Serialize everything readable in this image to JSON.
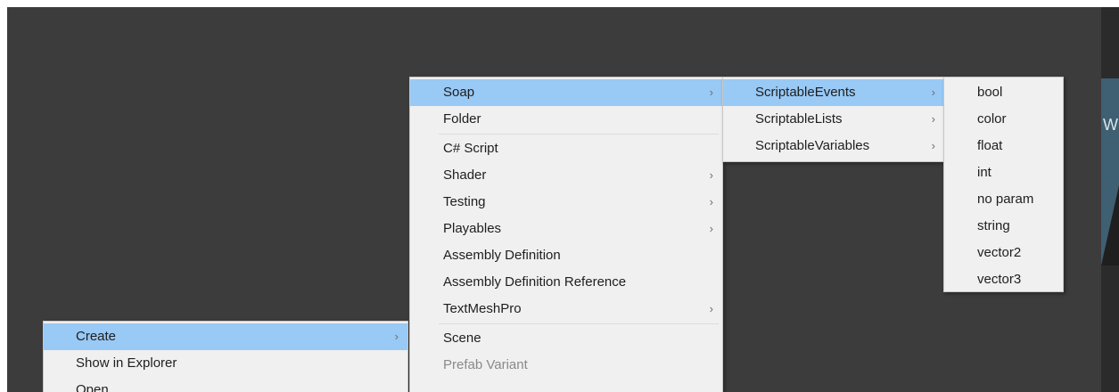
{
  "context_menu": {
    "items": [
      {
        "label": "Create",
        "submenu": true,
        "highlighted": true
      },
      {
        "label": "Show in Explorer"
      },
      {
        "label": "Open"
      }
    ]
  },
  "create_menu": {
    "items": [
      {
        "label": "Soap",
        "submenu": true,
        "highlighted": true
      },
      {
        "label": "Folder"
      },
      {
        "label": "C# Script"
      },
      {
        "label": "Shader",
        "submenu": true
      },
      {
        "label": "Testing",
        "submenu": true
      },
      {
        "label": "Playables",
        "submenu": true
      },
      {
        "label": "Assembly Definition"
      },
      {
        "label": "Assembly Definition Reference"
      },
      {
        "label": "TextMeshPro",
        "submenu": true
      },
      {
        "label": "Scene"
      },
      {
        "label": "Prefab Variant",
        "disabled": true
      }
    ]
  },
  "soap_menu": {
    "items": [
      {
        "label": "ScriptableEvents",
        "submenu": true,
        "highlighted": true
      },
      {
        "label": "ScriptableLists",
        "submenu": true
      },
      {
        "label": "ScriptableVariables",
        "submenu": true
      }
    ]
  },
  "events_menu": {
    "items": [
      {
        "label": "bool"
      },
      {
        "label": "color"
      },
      {
        "label": "float"
      },
      {
        "label": "int"
      },
      {
        "label": "no param"
      },
      {
        "label": "string"
      },
      {
        "label": "vector2"
      },
      {
        "label": "vector3"
      }
    ]
  },
  "right_panel": {
    "glyph": "W"
  },
  "colors": {
    "highlight": "#99c9f5",
    "menu_bg": "#f0f0f0",
    "editor_bg": "#3c3c3c",
    "disabled_text": "#8a8a8a"
  },
  "icons": {
    "submenu_arrow": "chevron-right-icon"
  }
}
